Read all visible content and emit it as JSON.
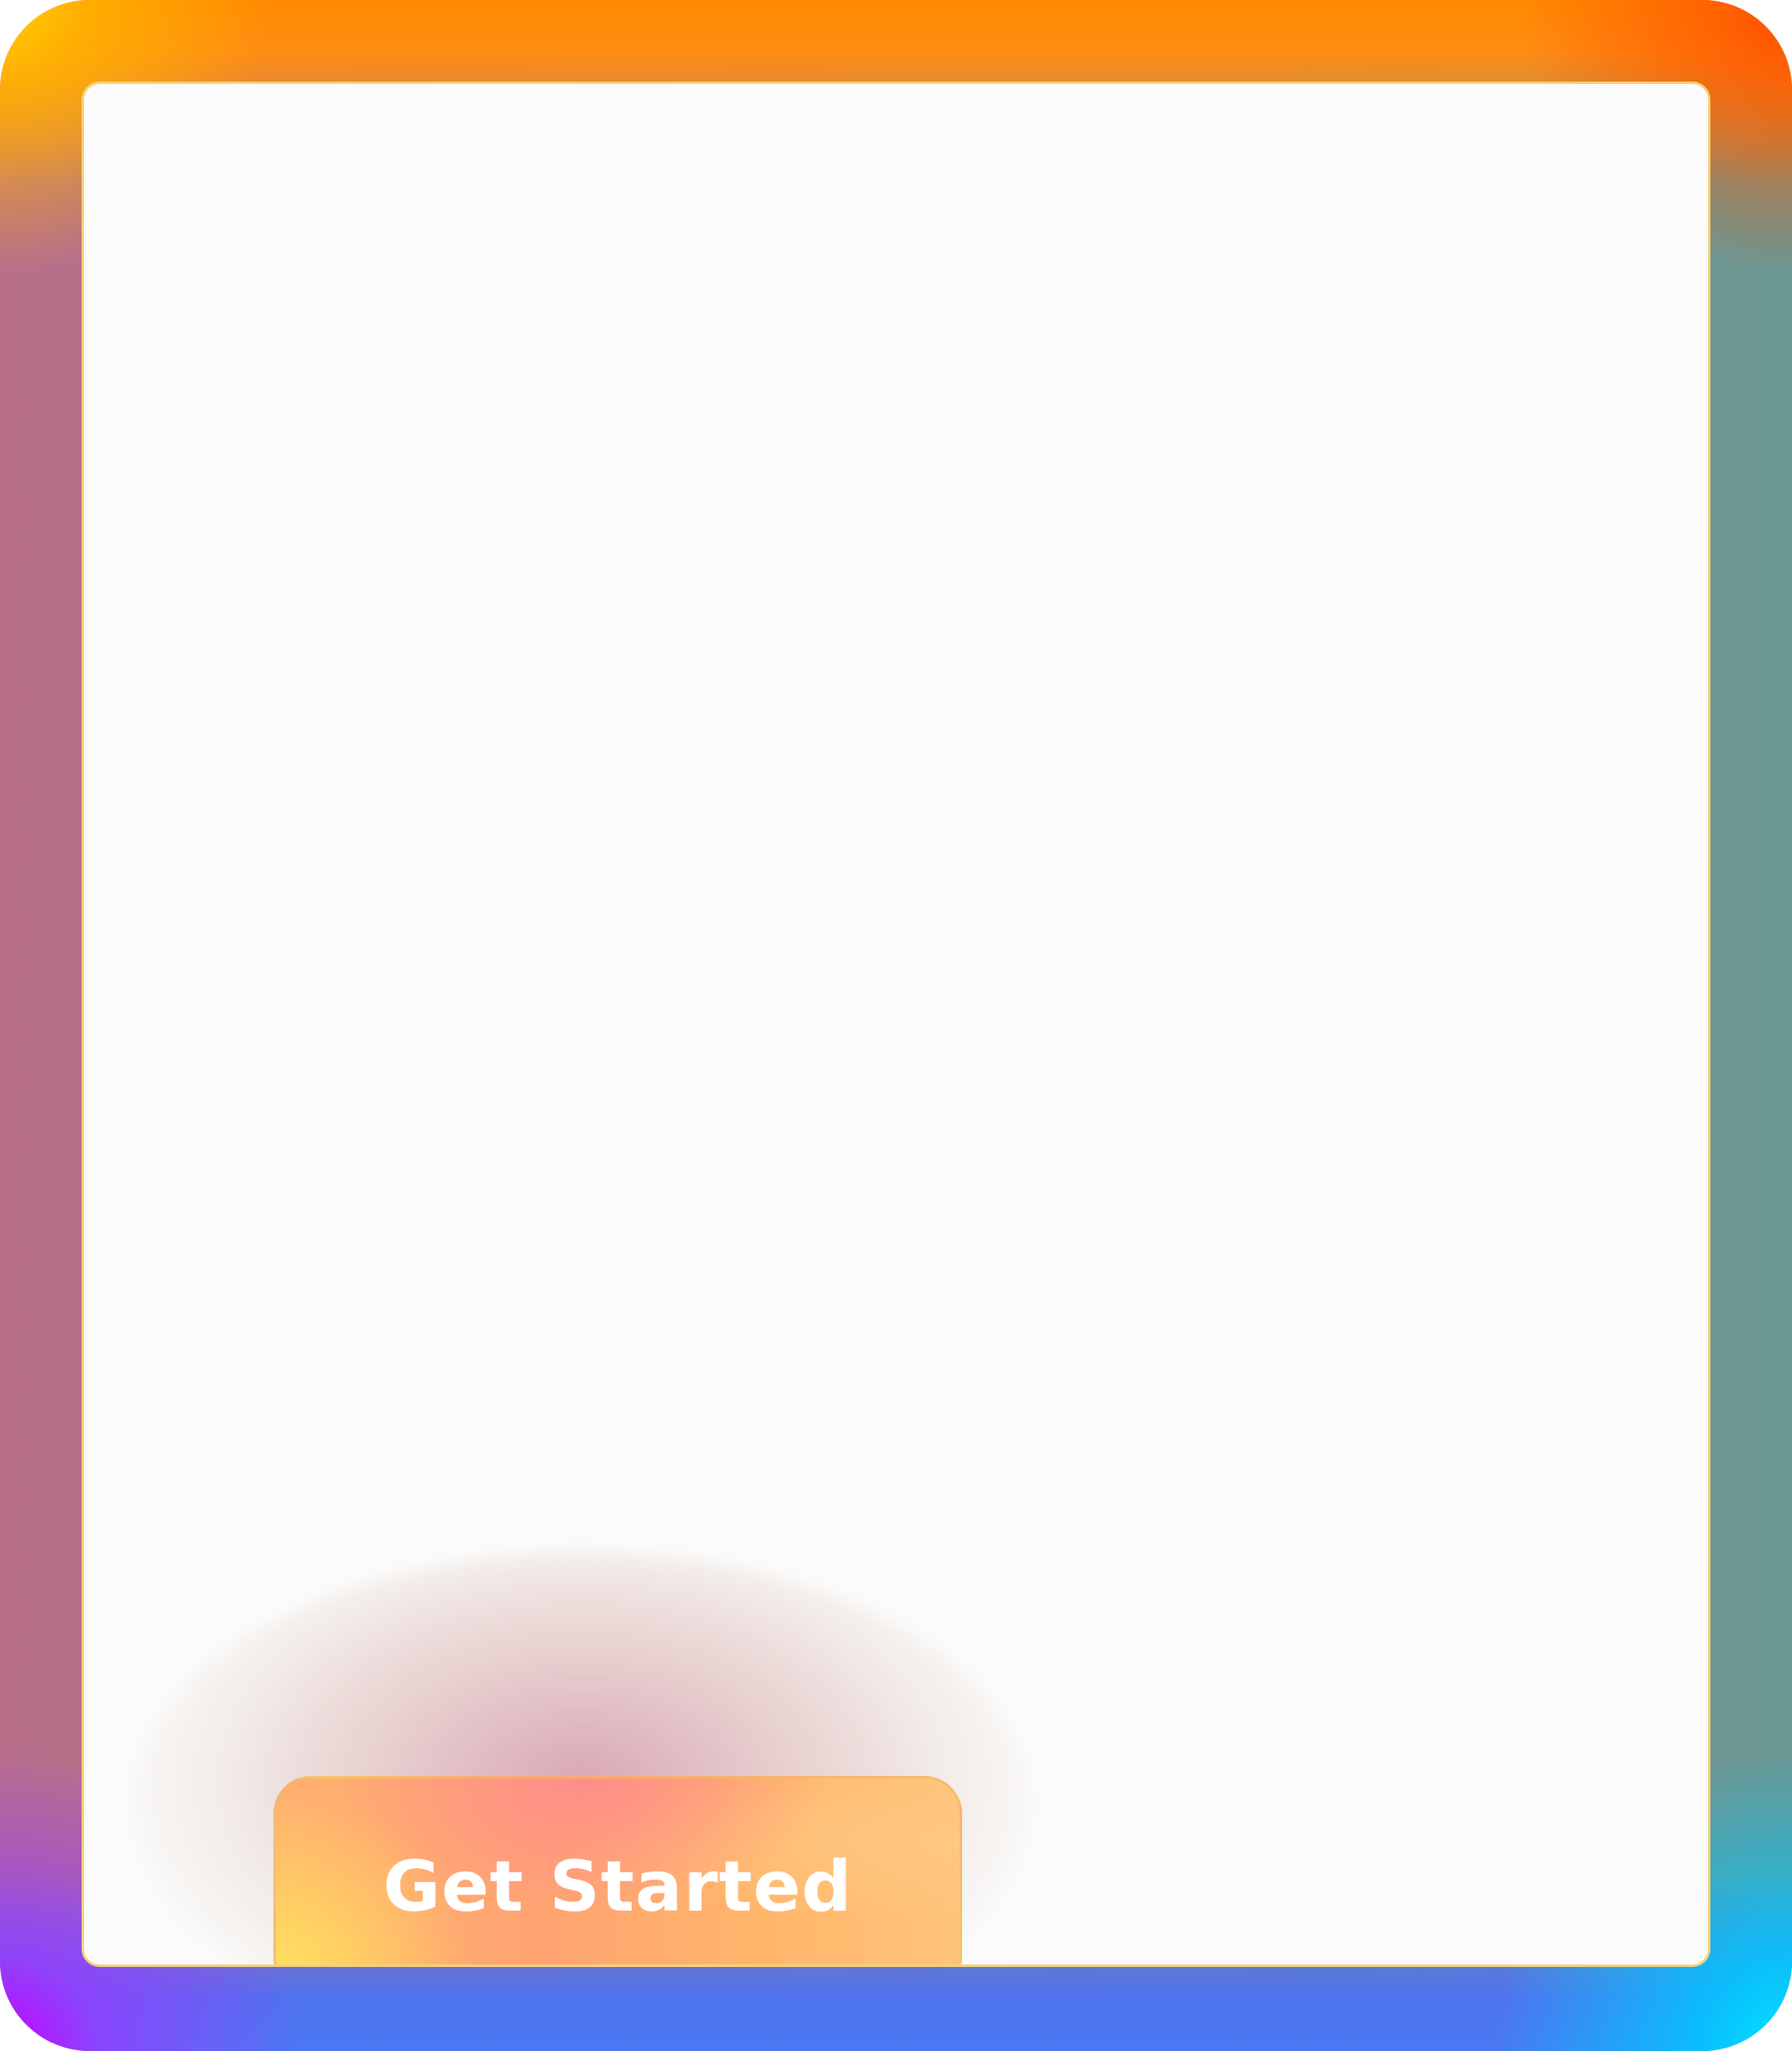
{
  "cta": {
    "label": "Get Started"
  },
  "colors": {
    "frame_top": "#ff8a00",
    "frame_bottom": "#4a78f2",
    "frame_side_left": "#b86f8a",
    "frame_side_right": "#6a9792",
    "corner_top_left": "#ffd400",
    "corner_top_right": "#ff4d00",
    "corner_bottom_left": "#c800ff",
    "corner_bottom_right": "#00e5ff",
    "card_background": "#fbfbfb",
    "card_border": "#f6d27a",
    "button_text": "#ffffff"
  }
}
